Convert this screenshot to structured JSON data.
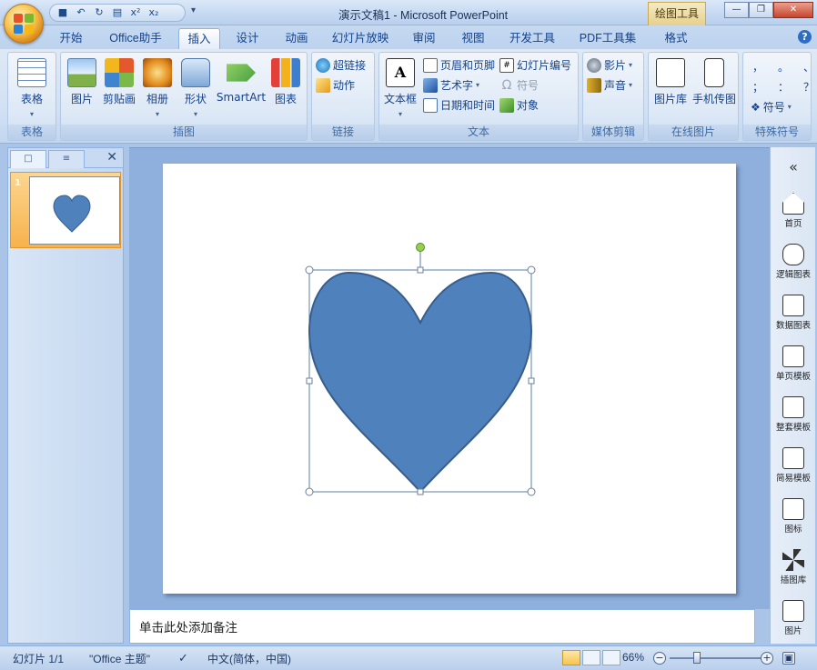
{
  "window": {
    "title": "演示文稿1 - Microsoft PowerPoint",
    "context_tab": "绘图工具",
    "controls": [
      "minimize",
      "restore",
      "close"
    ]
  },
  "quick_access": [
    "save-icon",
    "undo-icon",
    "redo-icon",
    "print-preview-icon",
    "superscript-icon",
    "subscript-icon"
  ],
  "quick_access_glyphs": {
    "superscript": "x²",
    "subscript": "x₂"
  },
  "tabs": [
    {
      "label": "开始"
    },
    {
      "label": "Office助手"
    },
    {
      "label": "插入",
      "active": true
    },
    {
      "label": "设计"
    },
    {
      "label": "动画"
    },
    {
      "label": "幻灯片放映"
    },
    {
      "label": "审阅"
    },
    {
      "label": "视图"
    },
    {
      "label": "开发工具"
    },
    {
      "label": "PDF工具集"
    },
    {
      "label": "格式"
    }
  ],
  "ribbon": {
    "groups": {
      "table": {
        "label": "表格",
        "items": {
          "table": "表格"
        }
      },
      "illustrations": {
        "label": "插图",
        "items": {
          "picture": "图片",
          "clipart": "剪贴画",
          "album": "相册",
          "shapes": "形状",
          "smartart": "SmartArt",
          "chart": "图表"
        }
      },
      "links": {
        "label": "链接",
        "items": {
          "hyperlink": "超链接",
          "action": "动作"
        }
      },
      "text": {
        "label": "文本",
        "items": {
          "textbox": "文本框",
          "header_footer": "页眉和页脚",
          "wordart": "艺术字",
          "datetime": "日期和时间",
          "slide_number": "幻灯片编号",
          "symbol": "符号",
          "object": "对象"
        }
      },
      "media": {
        "label": "媒体剪辑",
        "items": {
          "movie": "影片",
          "sound": "声音"
        }
      },
      "online_pictures": {
        "label": "在线图片",
        "items": {
          "gallery": "图片库",
          "phone": "手机传图"
        }
      },
      "special_symbols": {
        "label": "特殊符号",
        "items": {
          "symbol": "符号",
          "glyphs": [
            "，",
            "。",
            "、",
            "；",
            "：",
            "？"
          ]
        }
      }
    }
  },
  "left_panel": {
    "slide_number": "1",
    "tabs": [
      "slides-tab",
      "outline-tab"
    ]
  },
  "notes": {
    "placeholder": "单击此处添加备注"
  },
  "right_panel": {
    "items": [
      {
        "label": "首页"
      },
      {
        "label": "逻辑图表"
      },
      {
        "label": "数据图表"
      },
      {
        "label": "单页模板"
      },
      {
        "label": "整套模板"
      },
      {
        "label": "简易模板"
      },
      {
        "label": "图标"
      },
      {
        "label": "插图库"
      },
      {
        "label": "图片"
      }
    ]
  },
  "status_bar": {
    "slide_info": "幻灯片 1/1",
    "theme": "\"Office 主题\"",
    "language": "中文(简体，中国)",
    "zoom": "66%",
    "zoom_value": 66
  },
  "colors": {
    "heart_fill": "#4f81bd",
    "heart_stroke": "#385d8a",
    "selection": "#5b7fa6",
    "rotate_handle": "#92d050",
    "accent": "#15428b"
  }
}
